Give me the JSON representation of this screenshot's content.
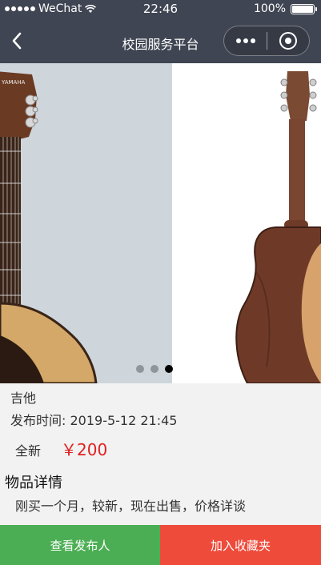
{
  "status_bar": {
    "carrier": "WeChat",
    "time": "22:46",
    "battery": "100%"
  },
  "nav": {
    "title": "校园服务平台",
    "back_icon": "chevron-left-icon",
    "more_icon": "more-dots-icon",
    "close_icon": "target-ring-icon"
  },
  "carousel": {
    "slides": 3,
    "active_index": 2
  },
  "item": {
    "name": "吉他",
    "publish_time": "发布时间: 2019-5-12 21:45",
    "condition": "全新",
    "price": "￥200"
  },
  "detail": {
    "heading": "物品详情",
    "text": "刚买一个月，较新，现在出售，价格详谈"
  },
  "actions": {
    "view_publisher": "查看发布人",
    "add_favorite": "加入收藏夹",
    "colors": {
      "publisher": "#4cae54",
      "favorite": "#ee4b3b"
    }
  }
}
